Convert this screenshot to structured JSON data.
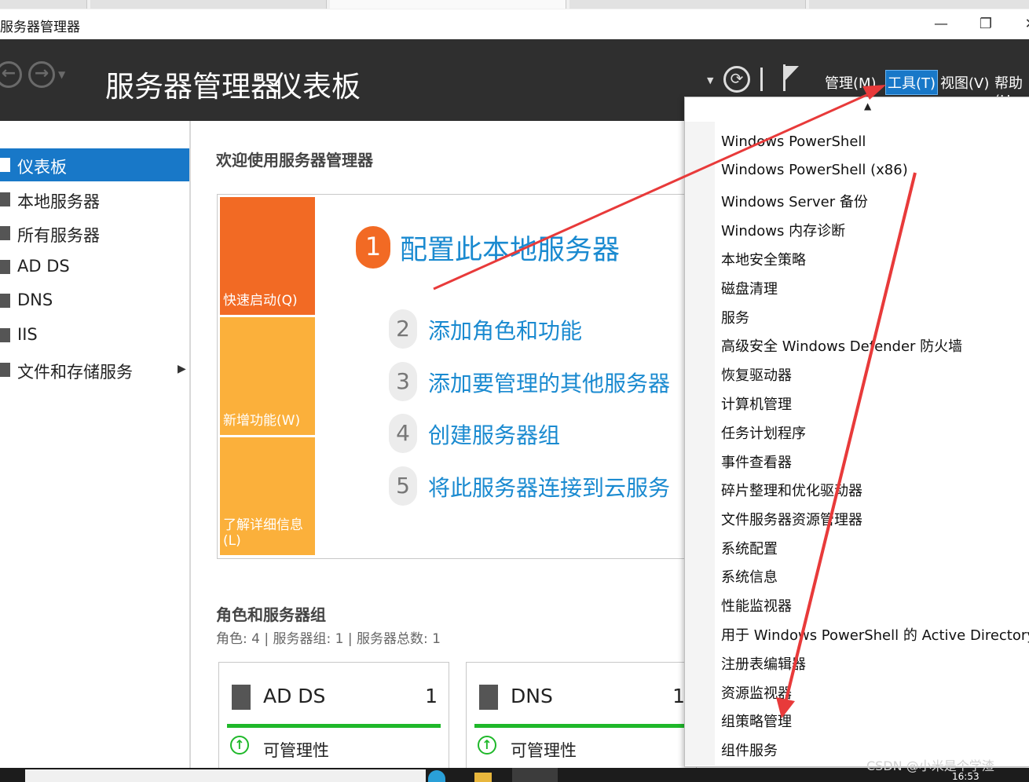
{
  "window": {
    "title": "服务器管理器",
    "buttons": {
      "minimize": "—",
      "restore": "❐",
      "close": "✕"
    }
  },
  "header": {
    "breadcrumb_root": "服务器管理器",
    "breadcrumb_sep": "‣",
    "breadcrumb_leaf": "仪表板",
    "menus": {
      "manage": "管理(M)",
      "tools": "工具(T)",
      "view": "视图(V)",
      "help": "帮助(H"
    }
  },
  "sidebar": {
    "items": [
      {
        "label": "仪表板",
        "active": true
      },
      {
        "label": "本地服务器"
      },
      {
        "label": "所有服务器"
      },
      {
        "label": "AD DS"
      },
      {
        "label": "DNS"
      },
      {
        "label": "IIS"
      },
      {
        "label": "文件和存储服务",
        "has_submenu": true
      }
    ]
  },
  "main": {
    "welcome": "欢迎使用服务器管理器",
    "tiles": {
      "quick_start": "快速启动(Q)",
      "whats_new": "新增功能(W)",
      "learn_more": "了解详细信息(L)"
    },
    "steps": [
      {
        "num": "1",
        "label": "配置此本地服务器"
      },
      {
        "num": "2",
        "label": "添加角色和功能"
      },
      {
        "num": "3",
        "label": "添加要管理的其他服务器"
      },
      {
        "num": "4",
        "label": "创建服务器组"
      },
      {
        "num": "5",
        "label": "将此服务器连接到云服务"
      }
    ],
    "groups_title": "角色和服务器组",
    "groups_summary": "角色: 4 | 服务器组: 1 | 服务器总数: 1",
    "cards": [
      {
        "name": "AD DS",
        "count": "1",
        "status": "可管理性"
      },
      {
        "name": "DNS",
        "count": "1",
        "status": "可管理性"
      }
    ]
  },
  "tools_menu": {
    "items": [
      "Windows PowerShell",
      "Windows PowerShell (x86)",
      "Windows Server 备份",
      "Windows 内存诊断",
      "本地安全策略",
      "磁盘清理",
      "服务",
      "高级安全 Windows Defender 防火墙",
      "恢复驱动器",
      "计算机管理",
      "任务计划程序",
      "事件查看器",
      "碎片整理和优化驱动器",
      "文件服务器资源管理器",
      "系统配置",
      "系统信息",
      "性能监视器",
      "用于 Windows PowerShell 的 Active Directory 模块",
      "注册表编辑器",
      "资源监视器",
      "组策略管理",
      "组件服务"
    ]
  },
  "taskbar": {
    "clock": "16:53"
  },
  "watermark": "CSDN @小米是个学渣",
  "colors": {
    "accent": "#1878c8",
    "header": "#2f2f2f",
    "orange": "#f26a24",
    "tile_light": "#fbb03b",
    "annotation": "#e83a3a"
  }
}
